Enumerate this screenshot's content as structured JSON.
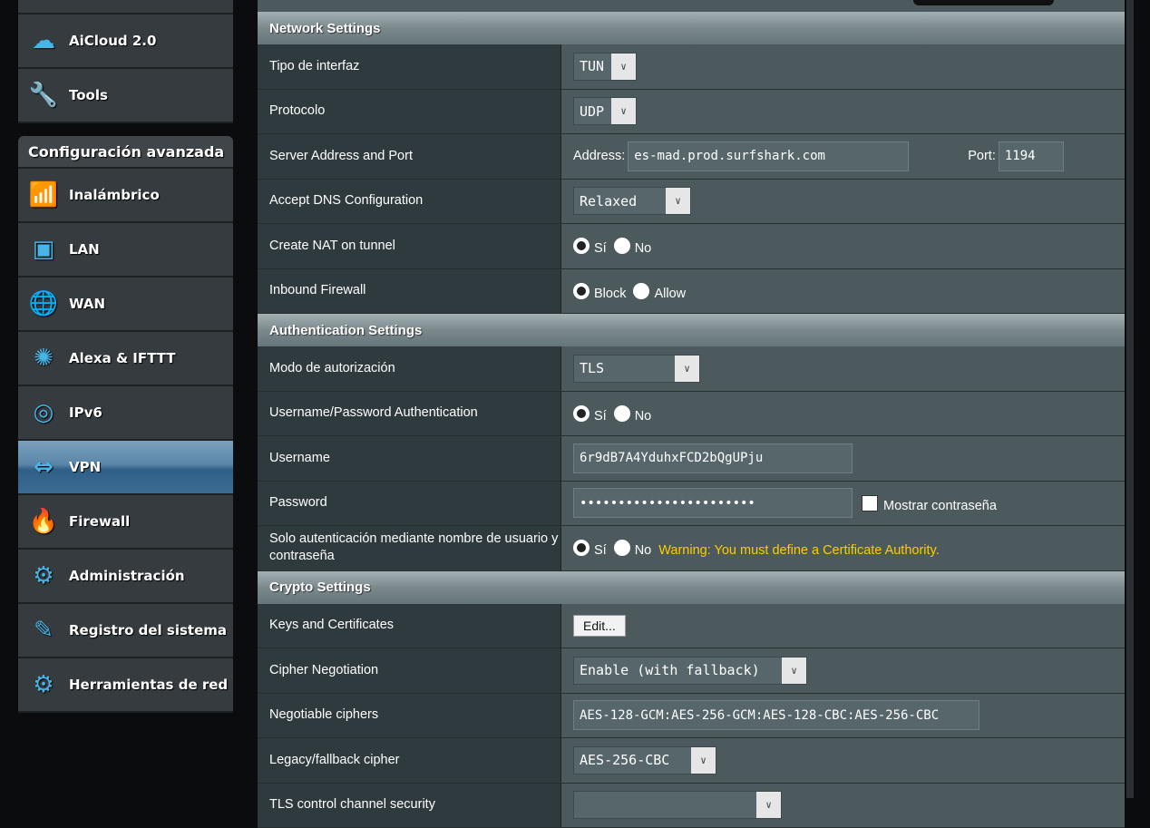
{
  "sidebar": {
    "top_items": [
      {
        "label": "AiCloud 2.0",
        "icon": "cloud-icon"
      },
      {
        "label": "Tools",
        "icon": "wrench-icon"
      }
    ],
    "section_title": "Configuración avanzada",
    "items": [
      {
        "label": "Inalámbrico",
        "icon": "wireless-icon"
      },
      {
        "label": "LAN",
        "icon": "lan-icon"
      },
      {
        "label": "WAN",
        "icon": "globe-icon"
      },
      {
        "label": "Alexa & IFTTT",
        "icon": "alexa-icon"
      },
      {
        "label": "IPv6",
        "icon": "ipv6-icon"
      },
      {
        "label": "VPN",
        "icon": "vpn-icon",
        "active": true
      },
      {
        "label": "Firewall",
        "icon": "firewall-icon"
      },
      {
        "label": "Administración",
        "icon": "gear-icon"
      },
      {
        "label": "Registro del sistema",
        "icon": "log-icon"
      },
      {
        "label": "Herramientas de red",
        "icon": "network-tools-icon"
      }
    ]
  },
  "sections": [
    {
      "title": "Network Settings",
      "rows": [
        {
          "label": "Tipo de interfaz",
          "type": "select",
          "value": "TUN"
        },
        {
          "label": "Protocolo",
          "type": "select",
          "value": "UDP"
        },
        {
          "label": "Server Address and Port",
          "type": "address",
          "address_label": "Address:",
          "address": "es-mad.prod.surfshark.com",
          "port_label": "Port:",
          "port": "1194"
        },
        {
          "label": "Accept DNS Configuration",
          "type": "select",
          "value": "Relaxed"
        },
        {
          "label": "Create NAT on tunnel",
          "type": "radio",
          "options": [
            "Sí",
            "No"
          ],
          "selected": 0
        },
        {
          "label": "Inbound Firewall",
          "type": "radio",
          "options": [
            "Block",
            "Allow"
          ],
          "selected": 0
        }
      ]
    },
    {
      "title": "Authentication Settings",
      "rows": [
        {
          "label": "Modo de autorización",
          "type": "select",
          "value": "TLS"
        },
        {
          "label": "Username/Password Authentication",
          "type": "radio",
          "options": [
            "Sí",
            "No"
          ],
          "selected": 0
        },
        {
          "label": "Username",
          "type": "input",
          "value": "6r9dB7A4YduhxFCD2bQgUPju"
        },
        {
          "label": "Password",
          "type": "password",
          "value": "•••••••••••••••••••••••",
          "checkbox_label": "Mostrar contraseña"
        },
        {
          "label": "Solo autenticación mediante nombre de usuario y contraseña",
          "type": "radio",
          "options": [
            "Sí",
            "No"
          ],
          "selected": 0,
          "warning": "Warning: You must define a Certificate Authority."
        }
      ]
    },
    {
      "title": "Crypto Settings",
      "rows": [
        {
          "label": "Keys and Certificates",
          "type": "button",
          "value": "Edit..."
        },
        {
          "label": "Cipher Negotiation",
          "type": "select",
          "value": "Enable (with fallback)"
        },
        {
          "label": "Negotiable ciphers",
          "type": "input",
          "value": "AES-128-GCM:AES-256-GCM:AES-128-CBC:AES-256-CBC"
        },
        {
          "label": "Legacy/fallback cipher",
          "type": "select",
          "value": "AES-256-CBC"
        },
        {
          "label": "TLS control channel security",
          "type": "select",
          "value": ""
        }
      ]
    }
  ]
}
